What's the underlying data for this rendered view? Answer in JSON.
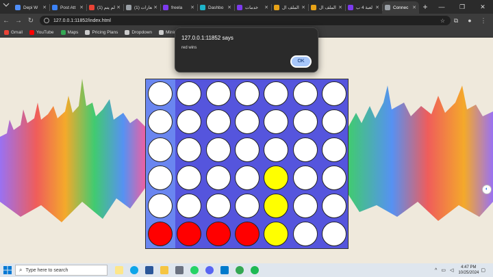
{
  "tabs": [
    {
      "label": "Depi W",
      "color": "#4f8ef7"
    },
    {
      "label": "Post Att",
      "color": "#3b82f6"
    },
    {
      "label": "(1) لم يتم",
      "color": "#ea4335"
    },
    {
      "label": "(1) إشعارات",
      "color": "#9aa0a6"
    },
    {
      "label": "freela",
      "color": "#7c3aed"
    },
    {
      "label": "Dashbo",
      "color": "#1db4c9"
    },
    {
      "label": "خدمات",
      "color": "#7c3aed"
    },
    {
      "label": "الملف ال",
      "color": "#e8a317"
    },
    {
      "label": "الملف ال",
      "color": "#e8a317"
    },
    {
      "label": "لعبة 4 ب",
      "color": "#7c3aed"
    },
    {
      "label": "Connec",
      "color": "#9aa0a6"
    }
  ],
  "window": {
    "minimize": "—",
    "maximize": "❐",
    "close": "✕",
    "newtab": "+"
  },
  "toolbar": {
    "back": "←",
    "forward": "→",
    "reload": "↻",
    "url": "127.0.0.1:11852/index.html",
    "star": "☆"
  },
  "bookmarks": [
    {
      "label": "Gmail",
      "color": "#ea4335"
    },
    {
      "label": "YouTube",
      "color": "#ff0000"
    },
    {
      "label": "Maps",
      "color": "#34a853"
    },
    {
      "label": "Pricing Plans",
      "color": "#cccccc"
    },
    {
      "label": "Dropdown",
      "color": "#cccccc"
    },
    {
      "label": "Minimalist bank",
      "color": "#cccccc"
    }
  ],
  "dialog": {
    "title": "127.0.0.1:11852 says",
    "message": "red wins",
    "ok_label": "OK"
  },
  "board": {
    "rows": 6,
    "cols": 7,
    "cells": [
      [
        "empty",
        "empty",
        "empty",
        "empty",
        "empty",
        "empty",
        "empty"
      ],
      [
        "empty",
        "empty",
        "empty",
        "empty",
        "empty",
        "empty",
        "empty"
      ],
      [
        "empty",
        "empty",
        "empty",
        "empty",
        "empty",
        "empty",
        "empty"
      ],
      [
        "empty",
        "empty",
        "empty",
        "empty",
        "yellow",
        "empty",
        "empty"
      ],
      [
        "empty",
        "empty",
        "empty",
        "empty",
        "yellow",
        "empty",
        "empty"
      ],
      [
        "red",
        "red",
        "red",
        "red",
        "yellow",
        "empty",
        "empty"
      ]
    ]
  },
  "taskbar": {
    "search_placeholder": "Type here to search",
    "time": "4:47 PM",
    "date": "10/25/2024"
  }
}
